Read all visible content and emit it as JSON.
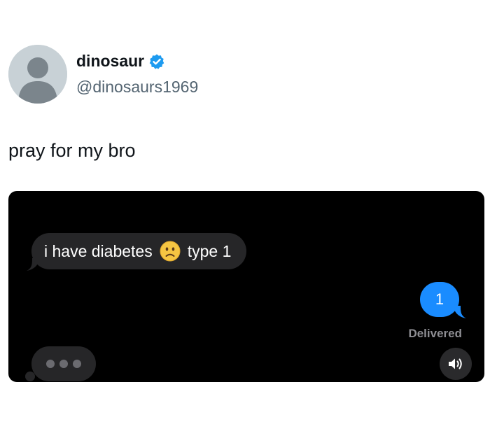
{
  "user": {
    "display_name": "dinosaur",
    "handle": "@dinosaurs1969",
    "verified": true,
    "avatar_icon": "default-avatar-icon"
  },
  "tweet": {
    "text": "pray for my bro"
  },
  "media": {
    "received_message": {
      "text_before": "i have diabetes",
      "emoji": "slightly-frowning-face",
      "text_after": "type 1"
    },
    "sent_message": {
      "text": "1",
      "status": "Delivered"
    },
    "typing_indicator": true,
    "sound_icon": "speaker-icon"
  },
  "colors": {
    "verified_blue": "#1d9bf0",
    "imessage_blue": "#1a8cff",
    "bubble_gray": "#262628"
  }
}
